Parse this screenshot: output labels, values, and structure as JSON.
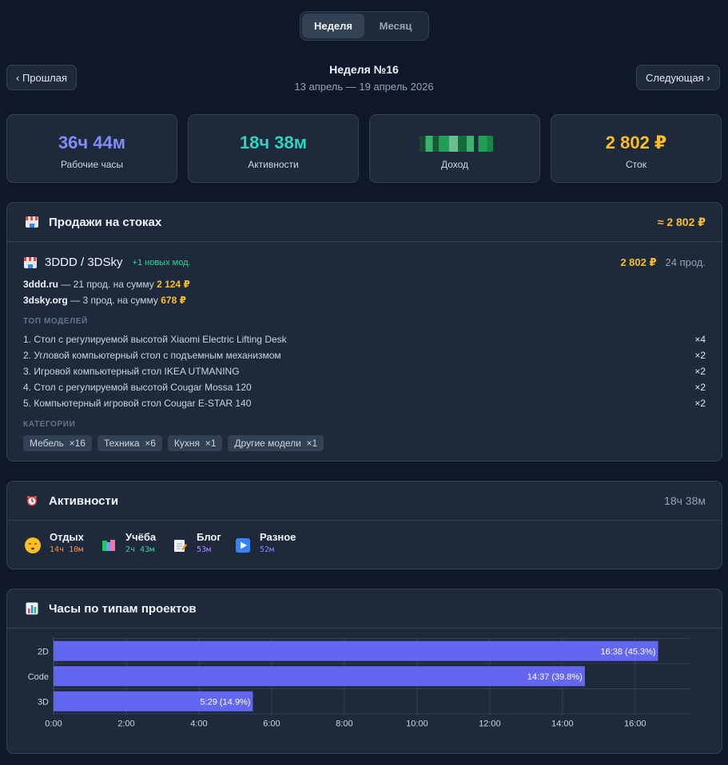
{
  "view_toggle": {
    "week": "Неделя",
    "month": "Месяц",
    "active": "week"
  },
  "nav": {
    "prev": "‹ Прошлая",
    "next": "Следующая ›",
    "title": "Неделя №16",
    "range": "13 апрель — 19 апрель 2026"
  },
  "stats": [
    {
      "value": "36ч 44м",
      "label": "Рабочие часы",
      "color": "#818cf8"
    },
    {
      "value": "18ч 38м",
      "label": "Активности",
      "color": "#2dd4bf"
    },
    {
      "value": "",
      "label": "Доход",
      "color": "#4ade80"
    },
    {
      "value": "2 802 ₽",
      "label": "Сток",
      "color": "#fbbf24"
    }
  ],
  "sales": {
    "title": "Продажи на стоках",
    "total": "≈ 2 802 ₽",
    "platform": {
      "name": "3DDD / 3DSky",
      "new_models": "+1 новых мод.",
      "sum": "2 802 ₽",
      "count": "24 прод."
    },
    "sources": [
      {
        "site": "3ddd.ru",
        "text": " — 21 прод. на сумму ",
        "sum": "2 124 ₽"
      },
      {
        "site": "3dsky.org",
        "text": " — 3 прод. на сумму ",
        "sum": "678 ₽"
      }
    ],
    "top_label": "ТОП МОДЕЛЕЙ",
    "top_models": [
      {
        "name": "1. Стол с регулируемой высотой Xiaomi Electric Lifting Desk",
        "count": "×4"
      },
      {
        "name": "2. Угловой компьютерный стол с подъемным механизмом",
        "count": "×2"
      },
      {
        "name": "3. Игровой компьютерный стол IKEA UTMANING",
        "count": "×2"
      },
      {
        "name": "4. Стол с регулируемой высотой Cougar Mossa 120",
        "count": "×2"
      },
      {
        "name": "5. Компьютерный игровой стол Cougar E-STAR 140",
        "count": "×2"
      }
    ],
    "categories_label": "КАТЕГОРИИ",
    "categories": [
      {
        "name": "Мебель",
        "count": "×16"
      },
      {
        "name": "Техника",
        "count": "×6"
      },
      {
        "name": "Кухня",
        "count": "×1"
      },
      {
        "name": "Другие модели",
        "count": "×1"
      }
    ]
  },
  "activities": {
    "title": "Активности",
    "total": "18ч 38м",
    "items": [
      {
        "name": "Отдых",
        "time": "14ч 10м",
        "color": "#fb923c",
        "icon": "sleepy-face-icon"
      },
      {
        "name": "Учёба",
        "time": "2ч 43м",
        "color": "#34d399",
        "icon": "books-icon"
      },
      {
        "name": "Блог",
        "time": "53м",
        "color": "#a78bfa",
        "icon": "memo-icon"
      },
      {
        "name": "Разное",
        "time": "52м",
        "color": "#818cf8",
        "icon": "play-button-icon"
      }
    ]
  },
  "hours_chart": {
    "title": "Часы по типам проектов"
  },
  "chart_data": {
    "type": "bar",
    "orientation": "horizontal",
    "title": "Часы по типам проектов",
    "categories": [
      "2D",
      "Code",
      "3D"
    ],
    "values": [
      16.633,
      14.617,
      5.483
    ],
    "data_labels": [
      "16:38 (45.3%)",
      "14:37 (39.8%)",
      "5:29 (14.9%)"
    ],
    "xticks": [
      "0:00",
      "2:00",
      "4:00",
      "6:00",
      "8:00",
      "10:00",
      "12:00",
      "14:00",
      "16:00"
    ],
    "xlim": [
      0,
      17.5
    ],
    "grid": true,
    "bar_color": "#6366f1"
  }
}
